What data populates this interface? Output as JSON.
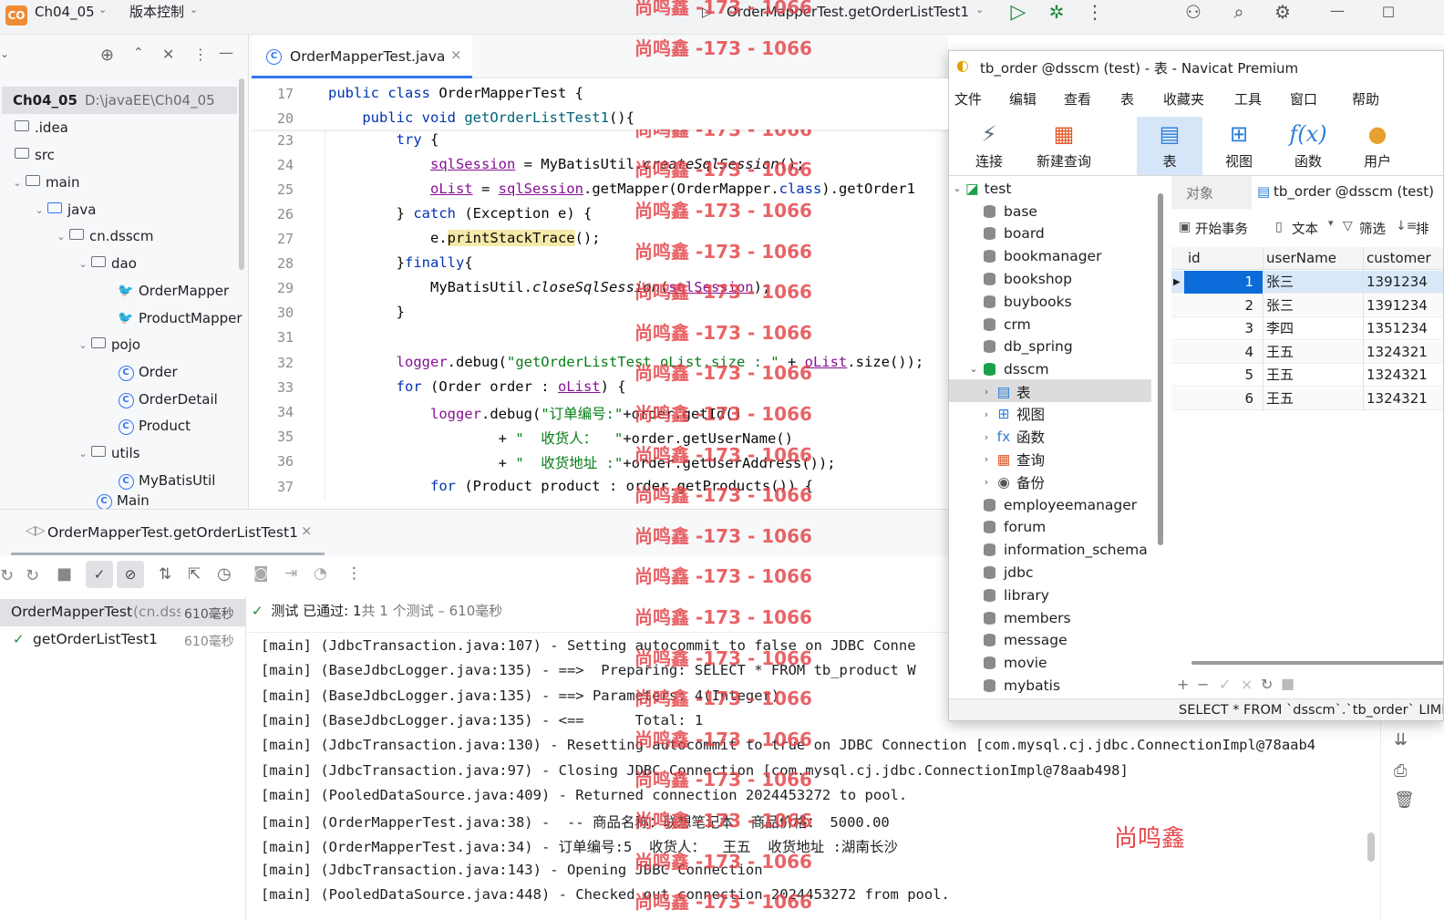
{
  "titlebar": {
    "project_badge": "CO",
    "project_name": "Ch04_05",
    "vcs": "版本控制",
    "run_config": "OrderMapperTest.getOrderListTest1"
  },
  "project": {
    "root_name": "Ch04_05",
    "root_path": "D:\\javaEE\\Ch04_05",
    "items": [
      {
        "label": "Ch04_05",
        "kind": "root"
      },
      {
        "label": ".idea",
        "kind": "folder"
      },
      {
        "label": "src",
        "kind": "folder"
      },
      {
        "label": "main",
        "kind": "folder"
      },
      {
        "label": "java",
        "kind": "folder"
      },
      {
        "label": "cn.dsscm",
        "kind": "package"
      },
      {
        "label": "dao",
        "kind": "package"
      },
      {
        "label": "OrderMapper",
        "kind": "mybatis"
      },
      {
        "label": "ProductMapper",
        "kind": "mybatis"
      },
      {
        "label": "pojo",
        "kind": "package"
      },
      {
        "label": "Order",
        "kind": "class"
      },
      {
        "label": "OrderDetail",
        "kind": "class"
      },
      {
        "label": "Product",
        "kind": "class"
      },
      {
        "label": "utils",
        "kind": "package"
      },
      {
        "label": "MyBatisUtil",
        "kind": "class"
      },
      {
        "label": "Main",
        "kind": "class"
      }
    ]
  },
  "editor": {
    "tab": "OrderMapperTest.java",
    "line_numbers": [
      "17",
      "20",
      "23",
      "24",
      "25",
      "26",
      "27",
      "28",
      "29",
      "30",
      "31",
      "32",
      "33",
      "34",
      "35",
      "36",
      "37"
    ]
  },
  "run": {
    "tab": "OrderMapperTest.getOrderListTest1",
    "status_pass": "测试 已通过: ",
    "status_count": "1",
    "status_rest": "共 1 个测试 – 610毫秒",
    "tests": [
      {
        "name": "OrderMapperTest",
        "pkg": "(cn.dssc",
        "time": "610毫秒"
      },
      {
        "name": "getOrderListTest1",
        "pkg": "",
        "time": "610毫秒"
      }
    ],
    "log_lines": [
      "[main] (JdbcTransaction.java:107) - Setting autocommit to false on JDBC Conne",
      "[main] (BaseJdbcLogger.java:135) - ==>  Preparing: SELECT * FROM tb_product W",
      "[main] (BaseJdbcLogger.java:135) - ==> Parameters: 4(Integer)",
      "[main] (BaseJdbcLogger.java:135) - <==      Total: 1",
      "[main] (JdbcTransaction.java:130) - Resetting autocommit to true on JDBC Connection [com.mysql.cj.jdbc.ConnectionImpl@78aab4",
      "[main] (JdbcTransaction.java:97) - Closing JDBC Connection [com.mysql.cj.jdbc.ConnectionImpl@78aab498]",
      "[main] (PooledDataSource.java:409) - Returned connection 2024453272 to pool.",
      "[main] (OrderMapperTest.java:38) -  -- 商品名称：联想笔记本  商品价格： 5000.00",
      "[main] (OrderMapperTest.java:34) - 订单编号:5  收货人：  王五  收货地址 :湖南长沙",
      "[main] (JdbcTransaction.java:143) - Opening JDBC Connection",
      "[main] (PooledDataSource.java:448) - Checked out connection 2024453272 from pool."
    ],
    "signature": "尚鸣鑫"
  },
  "navicat": {
    "title": "tb_order @dsscm (test) - 表 - Navicat Premium",
    "menu": [
      "文件",
      "编辑",
      "查看",
      "表",
      "收藏夹",
      "工具",
      "窗口",
      "帮助"
    ],
    "toolbar": [
      "连接",
      "新建查询",
      "表",
      "视图",
      "函数",
      "用户"
    ],
    "connection": "test",
    "databases": [
      "base",
      "board",
      "bookmanager",
      "bookshop",
      "buybooks",
      "crm",
      "db_spring"
    ],
    "open_db": "dsscm",
    "open_db_children": [
      "表",
      "视图",
      "函数",
      "查询",
      "备份"
    ],
    "databases_after": [
      "employeemanager",
      "forum",
      "information_schema",
      "jdbc",
      "library",
      "members",
      "message",
      "movie",
      "mybatis"
    ],
    "tabs": {
      "objects": "对象",
      "active": "tb_order @dsscm (test)"
    },
    "grid_toolbar": [
      "开始事务",
      "文本",
      "筛选",
      "排"
    ],
    "columns": [
      "id",
      "userName",
      "customer"
    ],
    "rows": [
      [
        "1",
        "张三",
        "1391234"
      ],
      [
        "2",
        "张三",
        "1391234"
      ],
      [
        "3",
        "李四",
        "1351234"
      ],
      [
        "4",
        "王五",
        "1324321"
      ],
      [
        "5",
        "王五",
        "1324321"
      ],
      [
        "6",
        "王五",
        "1324321"
      ]
    ],
    "status_sql": "SELECT * FROM `dsscm`.`tb_order` LIMI"
  },
  "watermark": "尚鸣鑫 -173 - 1066",
  "colors": {
    "accent": "#3574f0",
    "selection": "#0a6bd9",
    "watermark": "#e5484d",
    "pass": "#208a3c"
  }
}
